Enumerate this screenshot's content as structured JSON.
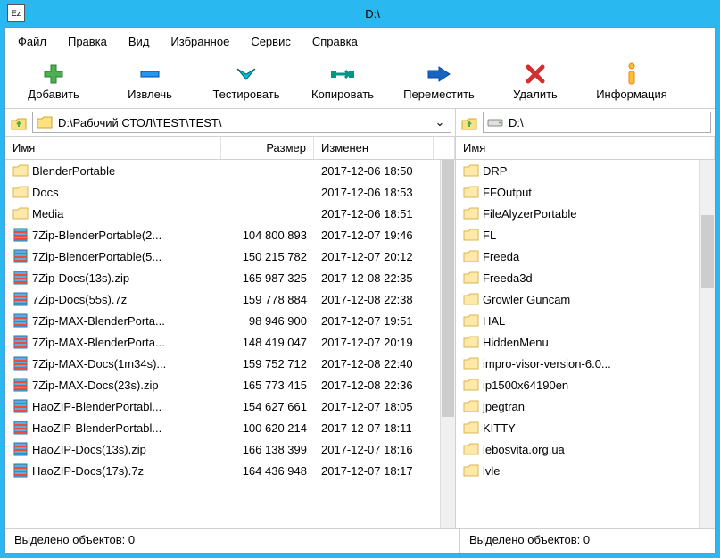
{
  "title": "D:\\",
  "titlebar_icon_text": "Ez",
  "menu": [
    "Файл",
    "Правка",
    "Вид",
    "Избранное",
    "Сервис",
    "Справка"
  ],
  "toolbar": [
    {
      "label": "Добавить",
      "icon": "add"
    },
    {
      "label": "Извлечь",
      "icon": "extract"
    },
    {
      "label": "Тестировать",
      "icon": "test"
    },
    {
      "label": "Копировать",
      "icon": "copy"
    },
    {
      "label": "Переместить",
      "icon": "move"
    },
    {
      "label": "Удалить",
      "icon": "delete"
    },
    {
      "label": "Информация",
      "icon": "info"
    }
  ],
  "left": {
    "path": "D:\\Рабочий СТОЛ\\TEST\\TEST\\",
    "columns": {
      "name": "Имя",
      "size": "Размер",
      "modified": "Изменен"
    },
    "items": [
      {
        "type": "folder",
        "name": "BlenderPortable",
        "size": "",
        "modified": "2017-12-06 18:50",
        "x": "2"
      },
      {
        "type": "folder",
        "name": "Docs",
        "size": "",
        "modified": "2017-12-06 18:53",
        "x": "2"
      },
      {
        "type": "folder",
        "name": "Media",
        "size": "",
        "modified": "2017-12-06 18:51",
        "x": "2"
      },
      {
        "type": "archive",
        "name": "7Zip-BlenderPortable(2...",
        "size": "104 800 893",
        "modified": "2017-12-07 19:46",
        "x": "2"
      },
      {
        "type": "archive",
        "name": "7Zip-BlenderPortable(5...",
        "size": "150 215 782",
        "modified": "2017-12-07 20:12",
        "x": "2"
      },
      {
        "type": "archive",
        "name": "7Zip-Docs(13s).zip",
        "size": "165 987 325",
        "modified": "2017-12-08 22:35",
        "x": "2"
      },
      {
        "type": "archive",
        "name": "7Zip-Docs(55s).7z",
        "size": "159 778 884",
        "modified": "2017-12-08 22:38",
        "x": "2"
      },
      {
        "type": "archive",
        "name": "7Zip-MAX-BlenderPorta...",
        "size": "98 946 900",
        "modified": "2017-12-07 19:51",
        "x": "2"
      },
      {
        "type": "archive",
        "name": "7Zip-MAX-BlenderPorta...",
        "size": "148 419 047",
        "modified": "2017-12-07 20:19",
        "x": "2"
      },
      {
        "type": "archive",
        "name": "7Zip-MAX-Docs(1m34s)...",
        "size": "159 752 712",
        "modified": "2017-12-08 22:40",
        "x": "2"
      },
      {
        "type": "archive",
        "name": "7Zip-MAX-Docs(23s).zip",
        "size": "165 773 415",
        "modified": "2017-12-08 22:36",
        "x": "2"
      },
      {
        "type": "archive",
        "name": "HaoZIP-BlenderPortabl...",
        "size": "154 627 661",
        "modified": "2017-12-07 18:05",
        "x": "2"
      },
      {
        "type": "archive",
        "name": "HaoZIP-BlenderPortabl...",
        "size": "100 620 214",
        "modified": "2017-12-07 18:11",
        "x": "2"
      },
      {
        "type": "archive",
        "name": "HaoZIP-Docs(13s).zip",
        "size": "166 138 399",
        "modified": "2017-12-07 18:16",
        "x": "2"
      },
      {
        "type": "archive",
        "name": "HaoZIP-Docs(17s).7z",
        "size": "164 436 948",
        "modified": "2017-12-07 18:17",
        "x": "2"
      }
    ]
  },
  "right": {
    "path": "D:\\",
    "columns": {
      "name": "Имя"
    },
    "items": [
      {
        "type": "folder",
        "name": "DRP"
      },
      {
        "type": "folder",
        "name": "FFOutput"
      },
      {
        "type": "folder",
        "name": "FileAlyzerPortable"
      },
      {
        "type": "folder",
        "name": "FL"
      },
      {
        "type": "folder",
        "name": "Freeda"
      },
      {
        "type": "folder",
        "name": "Freeda3d"
      },
      {
        "type": "folder",
        "name": "Growler Guncam"
      },
      {
        "type": "folder",
        "name": "HAL"
      },
      {
        "type": "folder",
        "name": "HiddenMenu"
      },
      {
        "type": "folder",
        "name": "impro-visor-version-6.0..."
      },
      {
        "type": "folder",
        "name": "ip1500x64190en"
      },
      {
        "type": "folder",
        "name": "jpegtran"
      },
      {
        "type": "folder",
        "name": "KITTY"
      },
      {
        "type": "folder",
        "name": "lebosvita.org.ua"
      },
      {
        "type": "folder",
        "name": "lvle"
      }
    ]
  },
  "status": {
    "left": "Выделено объектов: 0",
    "right": "Выделено объектов: 0"
  }
}
